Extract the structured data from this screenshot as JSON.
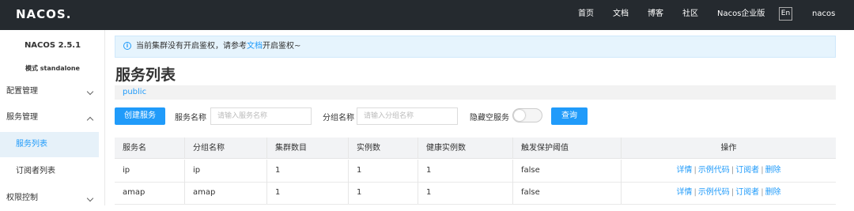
{
  "header": {
    "logo": "NACOS.",
    "nav": [
      "首页",
      "文档",
      "博客",
      "社区",
      "Nacos企业版"
    ],
    "lang": "En",
    "user": "nacos"
  },
  "sidebar": {
    "version": "NACOS 2.5.1",
    "mode": "模式 standalone",
    "items": [
      {
        "label": "配置管理"
      },
      {
        "label": "服务管理"
      },
      {
        "label": "服务列表"
      },
      {
        "label": "订阅者列表"
      },
      {
        "label": "权限控制"
      }
    ]
  },
  "notice": {
    "text_before": "当前集群没有开启鉴权，请参考",
    "link": "文档",
    "text_after": "开启鉴权~"
  },
  "page": {
    "title": "服务列表",
    "namespace": "public"
  },
  "filters": {
    "create_button": "创建服务",
    "service_name_label": "服务名称",
    "service_name_placeholder": "请输入服务名称",
    "group_name_label": "分组名称",
    "group_name_placeholder": "请输入分组名称",
    "hide_empty_label": "隐藏空服务",
    "query_button": "查询"
  },
  "table": {
    "headers": [
      "服务名",
      "分组名称",
      "集群数目",
      "实例数",
      "健康实例数",
      "触发保护阈值",
      "操作"
    ],
    "rows": [
      {
        "service": "ip",
        "group": "ip",
        "clusters": "1",
        "instances": "1",
        "healthy": "1",
        "protect": "false"
      },
      {
        "service": "amap",
        "group": "amap",
        "clusters": "1",
        "instances": "1",
        "healthy": "1",
        "protect": "false"
      }
    ],
    "actions": [
      "详情",
      "示例代码",
      "订阅者",
      "删除"
    ],
    "action_separator": "|"
  },
  "colors": {
    "topbar": "#252a2f",
    "primary": "#209bfa",
    "notice_bg": "#e6f4fd"
  }
}
